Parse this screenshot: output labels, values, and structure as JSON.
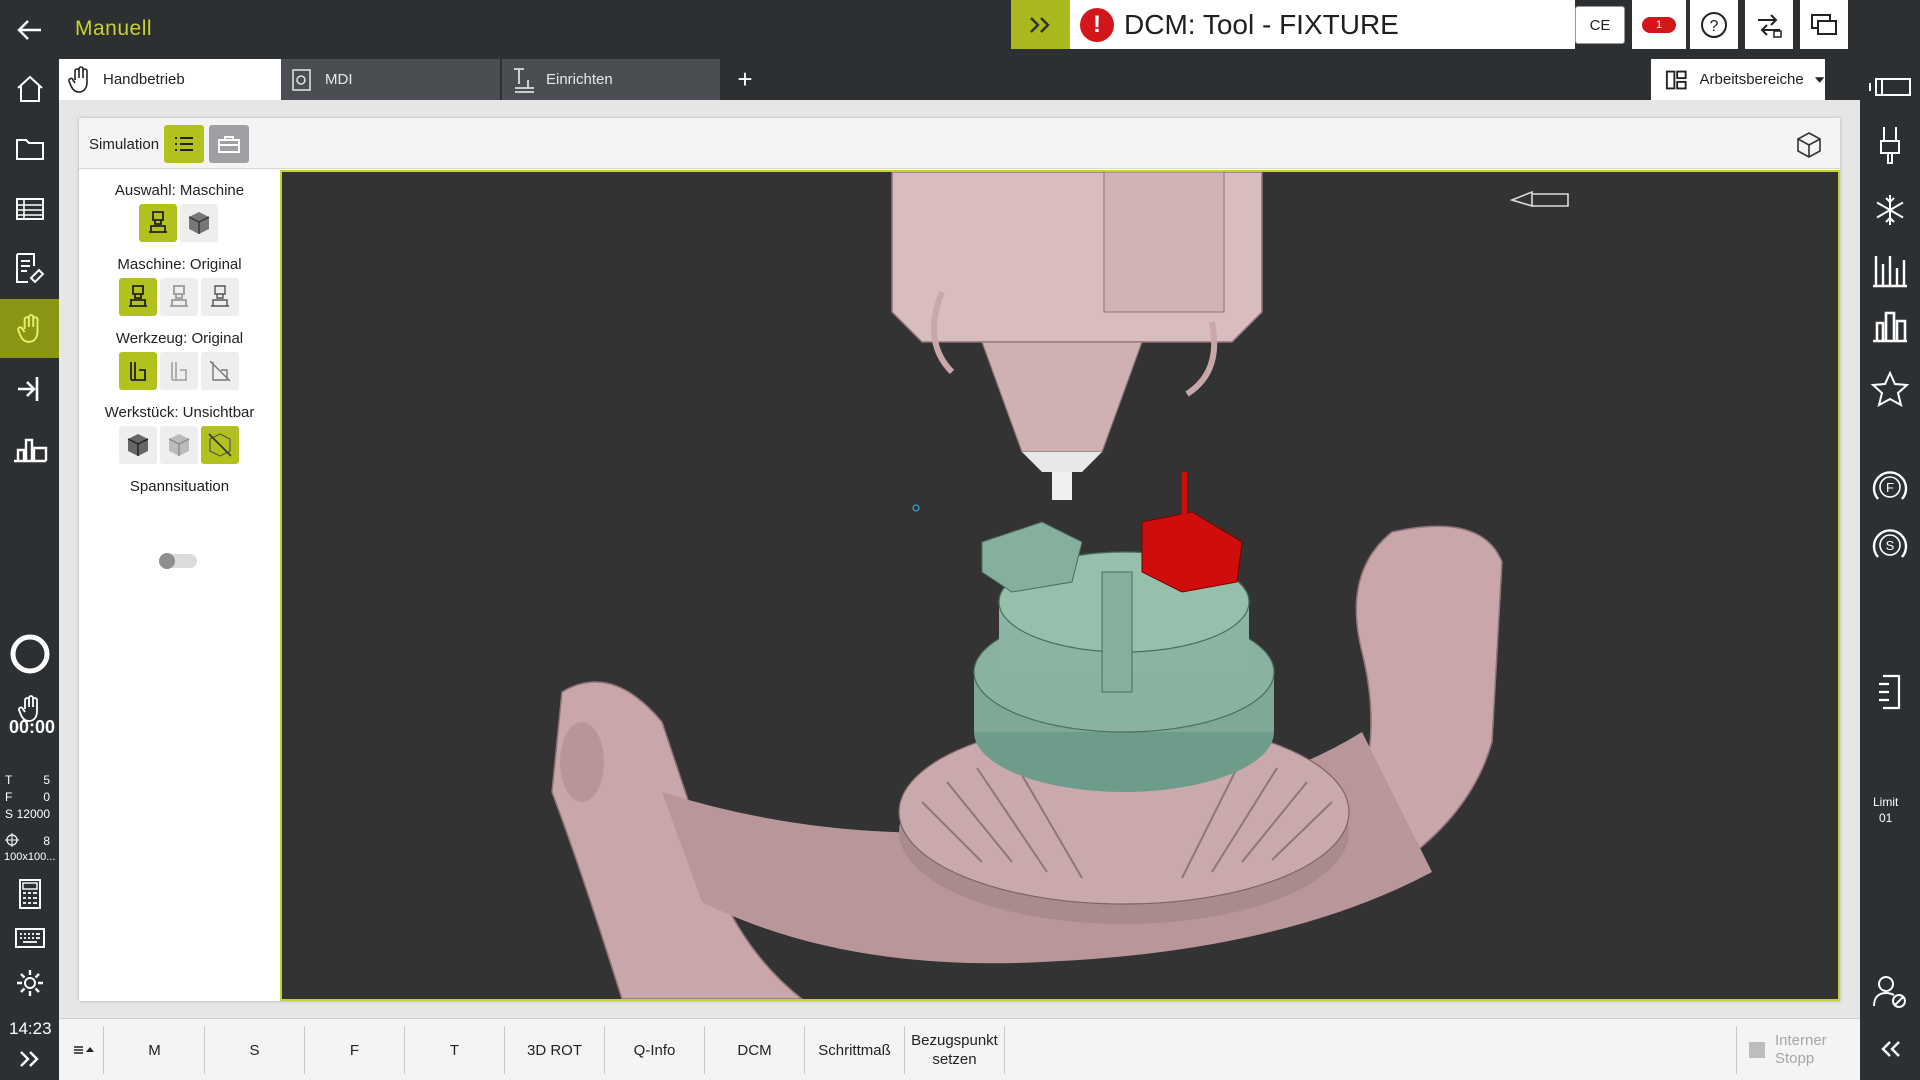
{
  "header": {
    "mode_title": "Manuell",
    "message": "DCM: Tool - FIXTURE",
    "ce_label": "CE",
    "error_count": "1",
    "accent_color": "#aab81d",
    "error_color": "#d3161b"
  },
  "tabs": [
    {
      "label": "Handbetrieb",
      "icon": "hand-icon",
      "active": true
    },
    {
      "label": "MDI",
      "icon": "mdi-icon",
      "active": false
    },
    {
      "label": "Einrichten",
      "icon": "setup-icon",
      "active": false
    }
  ],
  "workspaces_label": "Arbeitsbereiche",
  "left_status": {
    "time": "00:00",
    "t_label": "T",
    "t_value": "5",
    "f_label": "F",
    "f_value": "0",
    "s_label": "S",
    "s_value": "12000",
    "axis_value": "8",
    "preset": "100x100...",
    "clock": "14:23"
  },
  "right_status": {
    "limit_label": "Limit",
    "limit_value": "01"
  },
  "simulation": {
    "title": "Simulation",
    "selection_label": "Auswahl: Maschine",
    "machine_label": "Maschine: Original",
    "tool_label": "Werkzeug: Original",
    "workpiece_label": "Werkstück: Unsichtbar",
    "clamping_label": "Spannsituation"
  },
  "softkeys": [
    {
      "label": "M"
    },
    {
      "label": "S"
    },
    {
      "label": "F"
    },
    {
      "label": "T"
    },
    {
      "label": "3D ROT"
    },
    {
      "label": "Q-Info"
    },
    {
      "label": "DCM"
    },
    {
      "label": "Schrittmaß"
    },
    {
      "label_line1": "Bezugspunkt",
      "label_line2": "setzen"
    }
  ],
  "stop": {
    "line1": "Interner",
    "line2": "Stopp"
  }
}
